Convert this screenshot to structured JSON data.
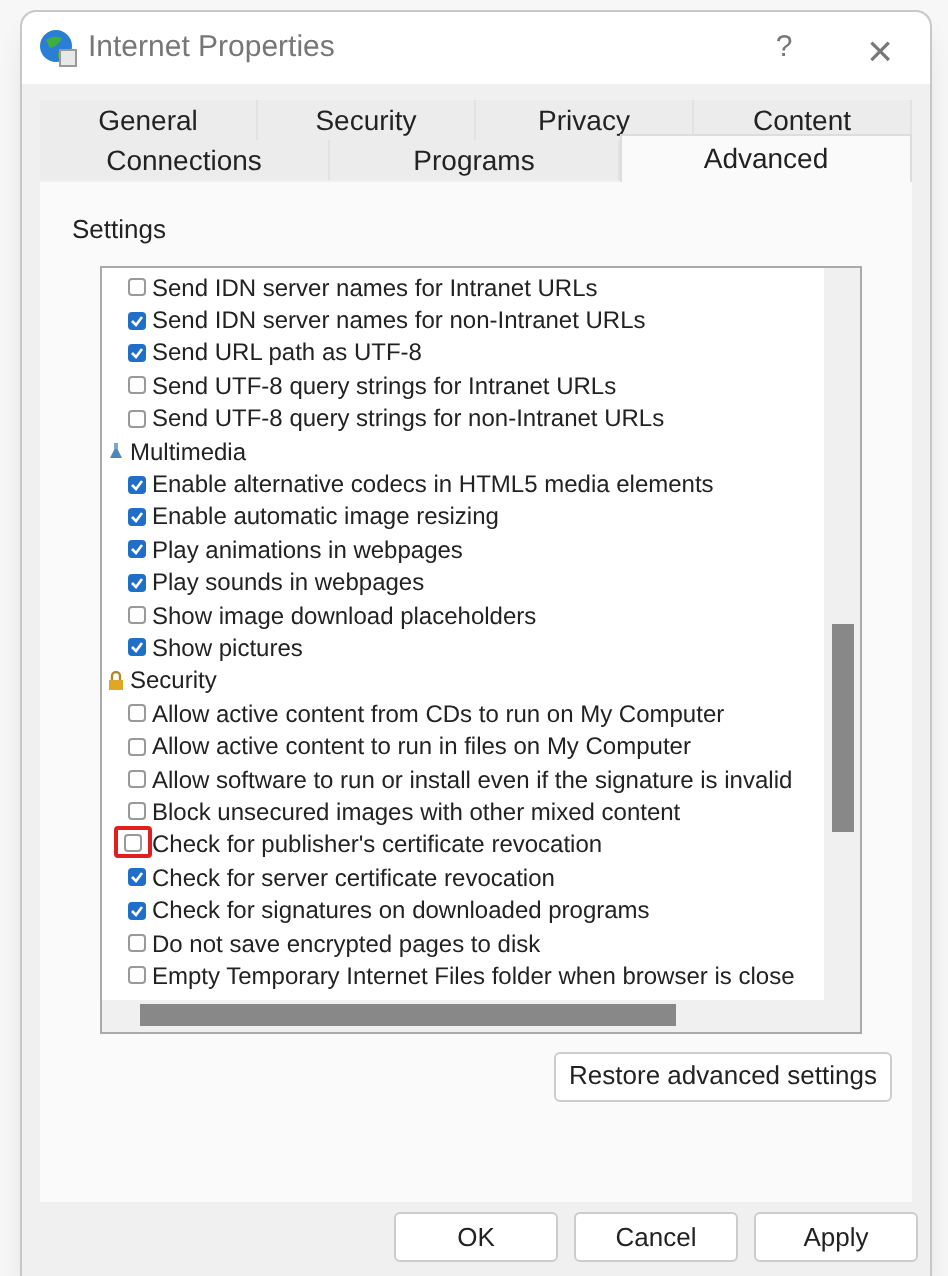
{
  "window": {
    "title": "Internet Properties",
    "help": "?",
    "close": "×"
  },
  "tabs_row_1": [
    {
      "label": "General",
      "selected": false
    },
    {
      "label": "Security",
      "selected": false
    },
    {
      "label": "Privacy",
      "selected": false
    },
    {
      "label": "Content",
      "selected": false
    }
  ],
  "tabs_row_2": [
    {
      "label": "Connections",
      "selected": false
    },
    {
      "label": "Programs",
      "selected": false
    },
    {
      "label": "Advanced",
      "selected": true
    }
  ],
  "settings": {
    "label": "Settings",
    "items": [
      {
        "kind": "option",
        "label": "Send IDN server names for Intranet URLs",
        "checked": false,
        "highlighted": false
      },
      {
        "kind": "option",
        "label": "Send IDN server names for non-Intranet URLs",
        "checked": true,
        "highlighted": false
      },
      {
        "kind": "option",
        "label": "Send URL path as UTF-8",
        "checked": true,
        "highlighted": false
      },
      {
        "kind": "option",
        "label": "Send UTF-8 query strings for Intranet URLs",
        "checked": false,
        "highlighted": false
      },
      {
        "kind": "option",
        "label": "Send UTF-8 query strings for non-Intranet URLs",
        "checked": false,
        "highlighted": false
      },
      {
        "kind": "media",
        "label": "Multimedia"
      },
      {
        "kind": "option",
        "label": "Enable alternative codecs in HTML5 media elements",
        "checked": true,
        "highlighted": false
      },
      {
        "kind": "option",
        "label": "Enable automatic image resizing",
        "checked": true,
        "highlighted": false
      },
      {
        "kind": "option",
        "label": "Play animations in webpages",
        "checked": true,
        "highlighted": false
      },
      {
        "kind": "option",
        "label": "Play sounds in webpages",
        "checked": true,
        "highlighted": false
      },
      {
        "kind": "option",
        "label": "Show image download placeholders",
        "checked": false,
        "highlighted": false
      },
      {
        "kind": "option",
        "label": "Show pictures",
        "checked": true,
        "highlighted": false
      },
      {
        "kind": "lock",
        "label": "Security"
      },
      {
        "kind": "option",
        "label": "Allow active content from CDs to run on My Computer",
        "checked": false,
        "highlighted": false
      },
      {
        "kind": "option",
        "label": "Allow active content to run in files on My Computer",
        "checked": false,
        "highlighted": false
      },
      {
        "kind": "option",
        "label": "Allow software to run or install even if the signature is invalid",
        "checked": false,
        "highlighted": false
      },
      {
        "kind": "option",
        "label": "Block unsecured images with other mixed content",
        "checked": false,
        "highlighted": false
      },
      {
        "kind": "option",
        "label": "Check for publisher's certificate revocation",
        "checked": false,
        "highlighted": true
      },
      {
        "kind": "option",
        "label": "Check for server certificate revocation",
        "checked": true,
        "highlighted": false
      },
      {
        "kind": "option",
        "label": "Check for signatures on downloaded programs",
        "checked": true,
        "highlighted": false
      },
      {
        "kind": "option",
        "label": "Do not save encrypted pages to disk",
        "checked": false,
        "highlighted": false
      },
      {
        "kind": "option",
        "label": "Empty Temporary Internet Files folder when browser is close",
        "checked": false,
        "highlighted": false
      }
    ]
  },
  "restore_button": "Restore advanced settings",
  "buttons": [
    "OK",
    "Cancel",
    "Apply"
  ]
}
